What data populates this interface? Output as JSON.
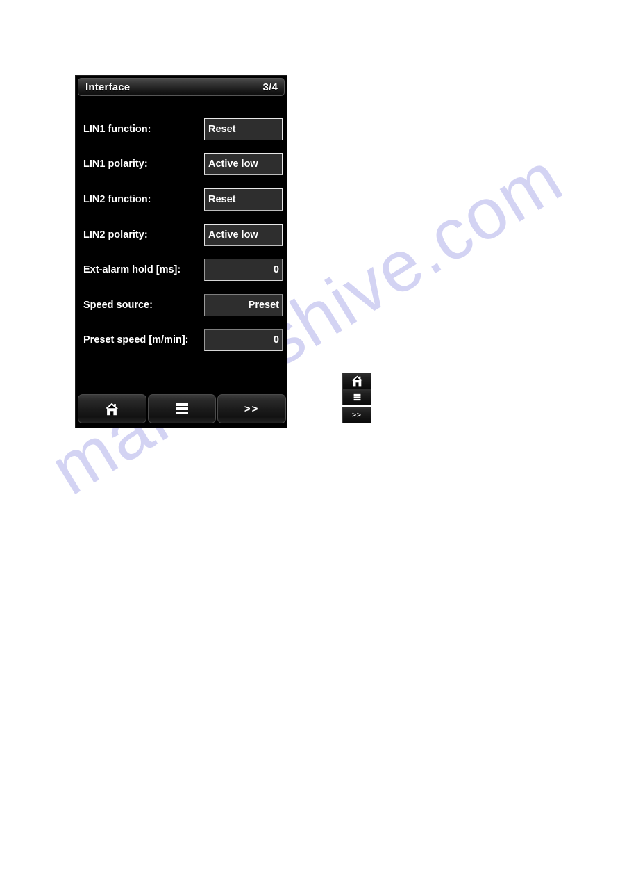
{
  "watermark": {
    "text": "manualshive.com"
  },
  "device": {
    "titlebar": {
      "title": "Interface",
      "page_indicator": "3/4"
    },
    "rows": [
      {
        "label": "LIN1 function:",
        "value": "Reset",
        "kind": "enum"
      },
      {
        "label": "LIN1 polarity:",
        "value": "Active low",
        "kind": "enum"
      },
      {
        "label": "LIN2 function:",
        "value": "Reset",
        "kind": "enum"
      },
      {
        "label": "LIN2 polarity:",
        "value": "Active low",
        "kind": "enum"
      },
      {
        "label": "Ext-alarm hold [ms]:",
        "value": "0",
        "kind": "num"
      },
      {
        "label": "Speed source:",
        "value": "Preset",
        "kind": "num"
      },
      {
        "label": "Preset speed [m/min]:",
        "value": "0",
        "kind": "num"
      }
    ],
    "toolbar": {
      "home_icon": "home-icon",
      "menu_icon": "list-menu-icon",
      "next_label": ">>"
    }
  },
  "mini_buttons": {
    "home_icon": "home-icon",
    "menu_icon": "list-menu-icon",
    "next_label": ">>"
  }
}
